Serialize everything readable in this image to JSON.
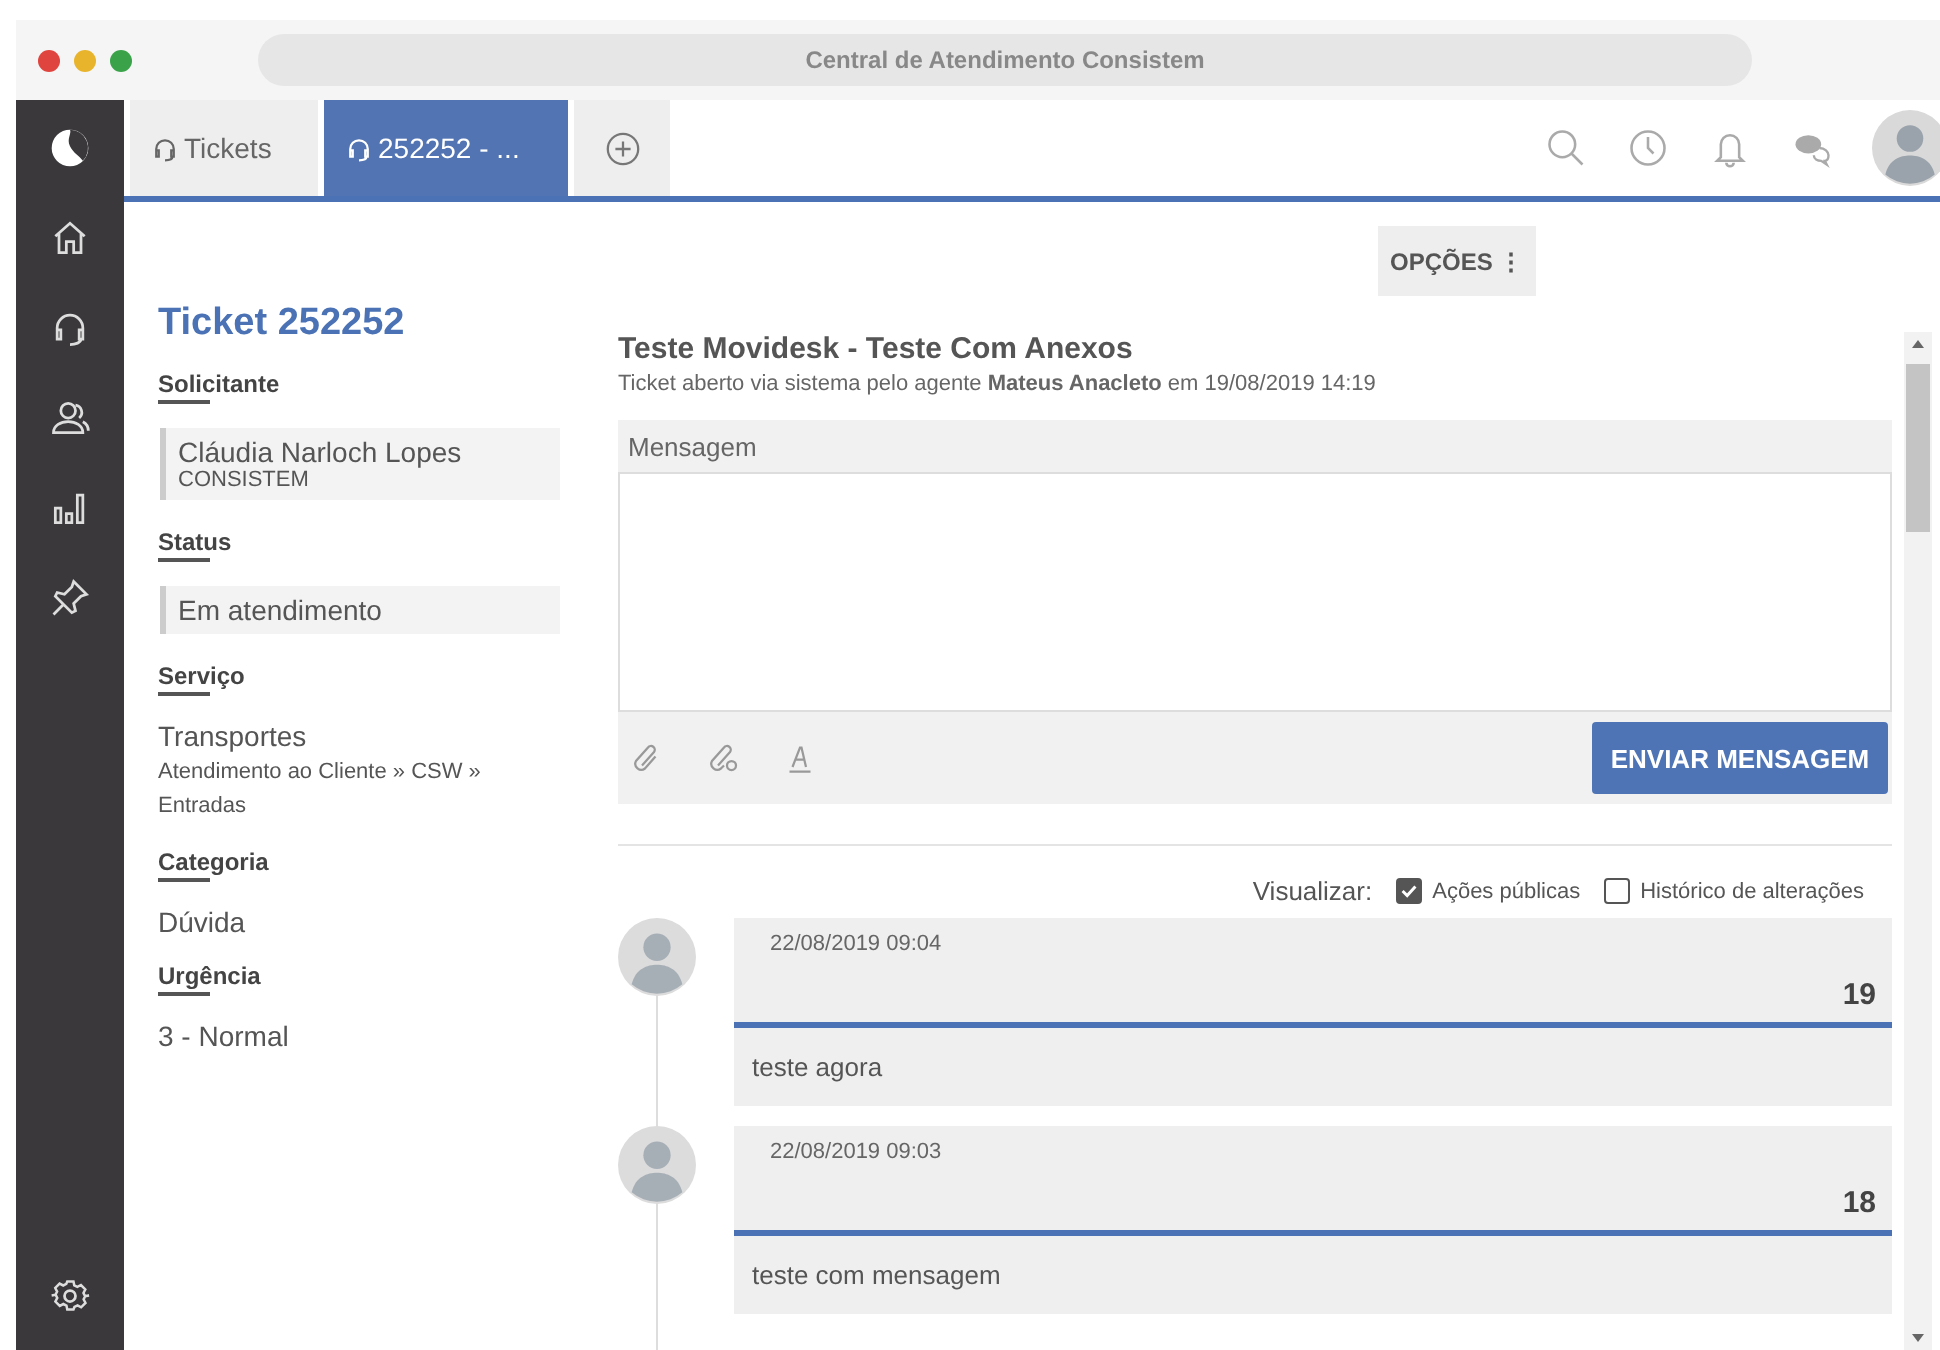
{
  "window": {
    "title": "Central de Atendimento Consistem"
  },
  "tabs": [
    {
      "label": "Tickets",
      "selected": false
    },
    {
      "label": "252252 - ...",
      "selected": true
    }
  ],
  "ticket": {
    "title": "Ticket 252252",
    "fields": [
      {
        "kind": "person",
        "label": "Solicitante",
        "value": "Cláudia Narloch Lopes",
        "detail": "CONSISTEM"
      },
      {
        "kind": "status",
        "label": "Status",
        "value": "Em atendimento"
      },
      {
        "kind": "service",
        "label": "Serviço",
        "value": "Transportes",
        "detail": "Atendimento ao Cliente » CSW » Entradas"
      },
      {
        "kind": "plain",
        "label": "Categoria",
        "value": "Dúvida"
      },
      {
        "kind": "plain",
        "label": "Urgência",
        "value": "3 - Normal"
      }
    ]
  },
  "options_button": "OPÇÕES ⋮",
  "subject": "Teste Movidesk - Teste Com Anexos",
  "opened_info": "Ticket aberto via sistema pelo agente **Mateus Anacleto** em 19/08/2019 14:19",
  "composer": {
    "label": "Mensagem",
    "send_button": "ENVIAR MENSAGEM"
  },
  "view_filter": {
    "label": "Visualizar:",
    "options": [
      {
        "label": "Ações públicas",
        "checked": true
      },
      {
        "label": "Histórico de alterações",
        "checked": false
      }
    ]
  },
  "messages": [
    {
      "date": "22/08/2019 09:04",
      "number": "19",
      "text": "teste agora"
    },
    {
      "date": "22/08/2019 09:03",
      "number": "18",
      "text": "teste com mensagem"
    }
  ]
}
